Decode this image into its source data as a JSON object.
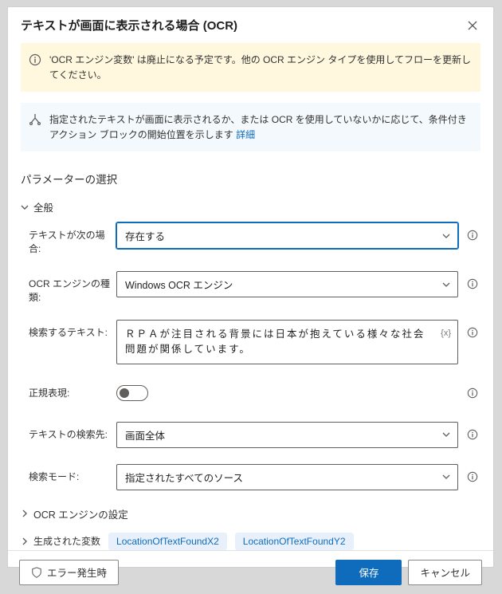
{
  "dialog": {
    "title": "テキストが画面に表示される場合 (OCR)"
  },
  "warning": {
    "text": "'OCR エンジン変数' は廃止になる予定です。他の OCR エンジン タイプを使用してフローを更新してください。"
  },
  "info": {
    "text": "指定されたテキストが画面に表示されるか、または OCR を使用していないかに応じて、条件付きアクション ブロックの開始位置を示します ",
    "link_label": "詳細"
  },
  "sections": {
    "params_title": "パラメーターの選択",
    "general_label": "全般",
    "ocr_settings_label": "OCR エンジンの設定",
    "generated_vars_label": "生成された変数"
  },
  "fields": {
    "if_text": {
      "label": "テキストが次の場合:",
      "value": "存在する"
    },
    "ocr_engine": {
      "label": "OCR エンジンの種類:",
      "value": "Windows OCR エンジン"
    },
    "search_text": {
      "label": "検索するテキスト:",
      "value": "ＲＰＡが注目される背景には日本が抱えている様々な社会問題が関係しています。",
      "fx": "{x}"
    },
    "regex": {
      "label": "正規表現:"
    },
    "search_target": {
      "label": "テキストの検索先:",
      "value": "画面全体"
    },
    "search_mode": {
      "label": "検索モード:",
      "value": "指定されたすべてのソース"
    }
  },
  "vars": {
    "chips": [
      "LocationOfTextFoundX2",
      "LocationOfTextFoundY2"
    ]
  },
  "footer": {
    "on_error": "エラー発生時",
    "save": "保存",
    "cancel": "キャンセル"
  }
}
